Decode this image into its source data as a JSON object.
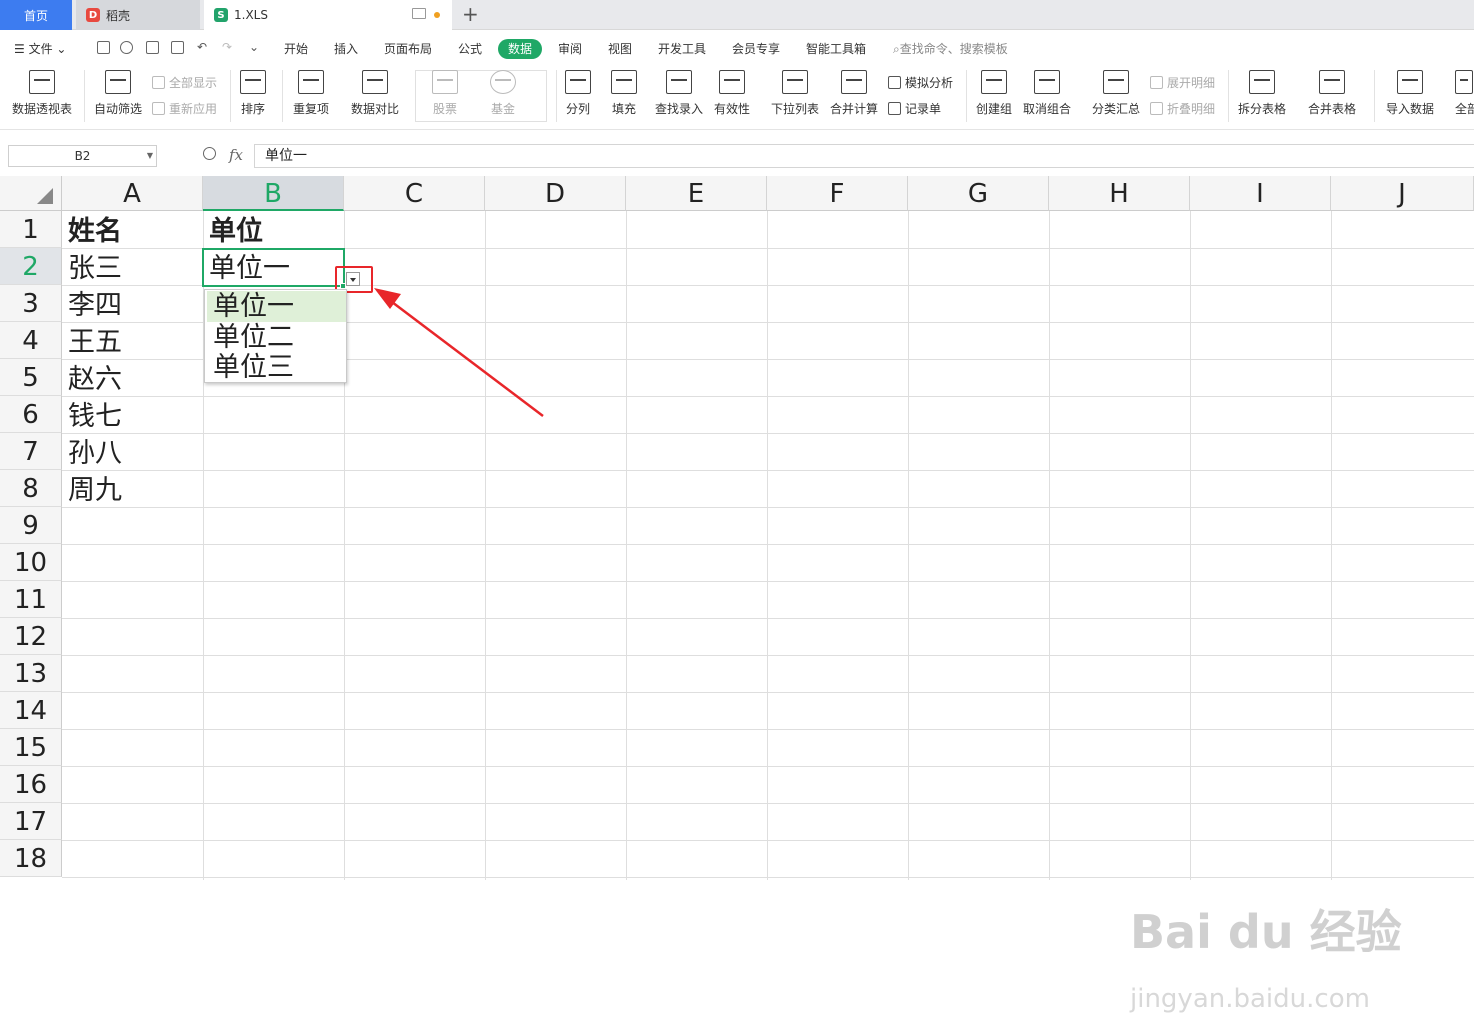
{
  "tabs": {
    "home": "首页",
    "daoke": "稻壳",
    "file": "1.XLS"
  },
  "menu": {
    "file": "文件",
    "items": [
      "开始",
      "插入",
      "页面布局",
      "公式",
      "数据",
      "审阅",
      "视图",
      "开发工具",
      "会员专享",
      "智能工具箱"
    ],
    "active": "数据",
    "search_placeholder": "查找命令、搜索模板"
  },
  "ribbon": {
    "pivot": "数据透视表",
    "autofilter": "自动筛选",
    "show_all": "全部显示",
    "reapply": "重新应用",
    "sort": "排序",
    "duplicates": "重复项",
    "compare": "数据对比",
    "stock": "股票",
    "fund": "基金",
    "split": "分列",
    "fill": "填充",
    "lookup": "查找录入",
    "validity": "有效性",
    "dropdown_list": "下拉列表",
    "consolidate": "合并计算",
    "simulate": "模拟分析",
    "record": "记录单",
    "create_group": "创建组",
    "ungroup": "取消组合",
    "subtotal": "分类汇总",
    "expand_detail": "展开明细",
    "collapse_detail": "折叠明细",
    "split_table": "拆分表格",
    "merge_table": "合并表格",
    "import_data": "导入数据",
    "more": "全部"
  },
  "formula_bar": {
    "name_box": "B2",
    "fx": "fx",
    "value": "单位一"
  },
  "columns": [
    "A",
    "B",
    "C",
    "D",
    "E",
    "F",
    "G",
    "H",
    "I",
    "J"
  ],
  "selected_column": "B",
  "rows": [
    "1",
    "2",
    "3",
    "4",
    "5",
    "6",
    "7",
    "8",
    "9",
    "10",
    "11",
    "12",
    "13",
    "14",
    "15",
    "16",
    "17",
    "18"
  ],
  "selected_row": "2",
  "cells": {
    "A1": "姓名",
    "B1": "单位",
    "A2": "张三",
    "B2": "单位一",
    "A3": "李四",
    "A4": "王五",
    "A5": "赵六",
    "A6": "钱七",
    "A7": "孙八",
    "A8": "周九"
  },
  "dropdown_options": [
    "单位一",
    "单位二",
    "单位三"
  ],
  "watermark": {
    "logo": "Bai du 经验",
    "url": "jingyan.baidu.com"
  }
}
